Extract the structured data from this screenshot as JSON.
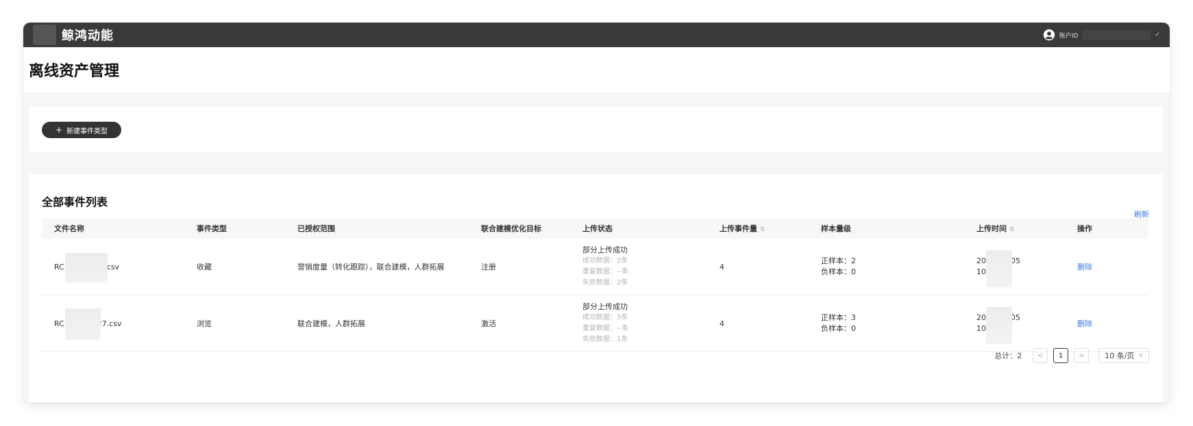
{
  "app": {
    "brand": "鲸鸿动能"
  },
  "user": {
    "label": "账户ID"
  },
  "page": {
    "title": "离线资产管理"
  },
  "actions": {
    "new_event_type": "新建事件类型"
  },
  "list": {
    "title": "全部事件列表",
    "refresh_label": "刷新",
    "columns": [
      "文件名称",
      "事件类型",
      "已授权范围",
      "联合建模优化目标",
      "上传状态",
      "上传事件量",
      "样本量级",
      "上传时间",
      "操作"
    ],
    "rows": [
      {
        "file_prefix": "RC",
        "file_suffix": "csv",
        "event_type": "收藏",
        "scope": "营销度量（转化跟踪），联合建模，人群拓展",
        "target": "注册",
        "status": "部分上传成功",
        "success": "成功数据：2条",
        "duplicate": "重复数据：--条",
        "failed": "失败数据：2条",
        "count": "4",
        "positive": "正样本：2",
        "negative": "负样本：0",
        "time_a": "20",
        "time_b": "05",
        "time_c": "10",
        "action": "删除"
      },
      {
        "file_prefix": "RC",
        "file_suffix": "27.csv",
        "event_type": "浏览",
        "scope": "联合建模，人群拓展",
        "target": "激活",
        "status": "部分上传成功",
        "success": "成功数据：3条",
        "duplicate": "重复数据：--条",
        "failed": "失败数据：1条",
        "count": "4",
        "positive": "正样本：3",
        "negative": "负样本：0",
        "time_a": "20",
        "time_b": "05",
        "time_c": "10",
        "action": "删除"
      }
    ]
  },
  "pagination": {
    "total": "总计：2",
    "prev": "<",
    "current": "1",
    "next": ">",
    "page_size": "10 条/页"
  }
}
